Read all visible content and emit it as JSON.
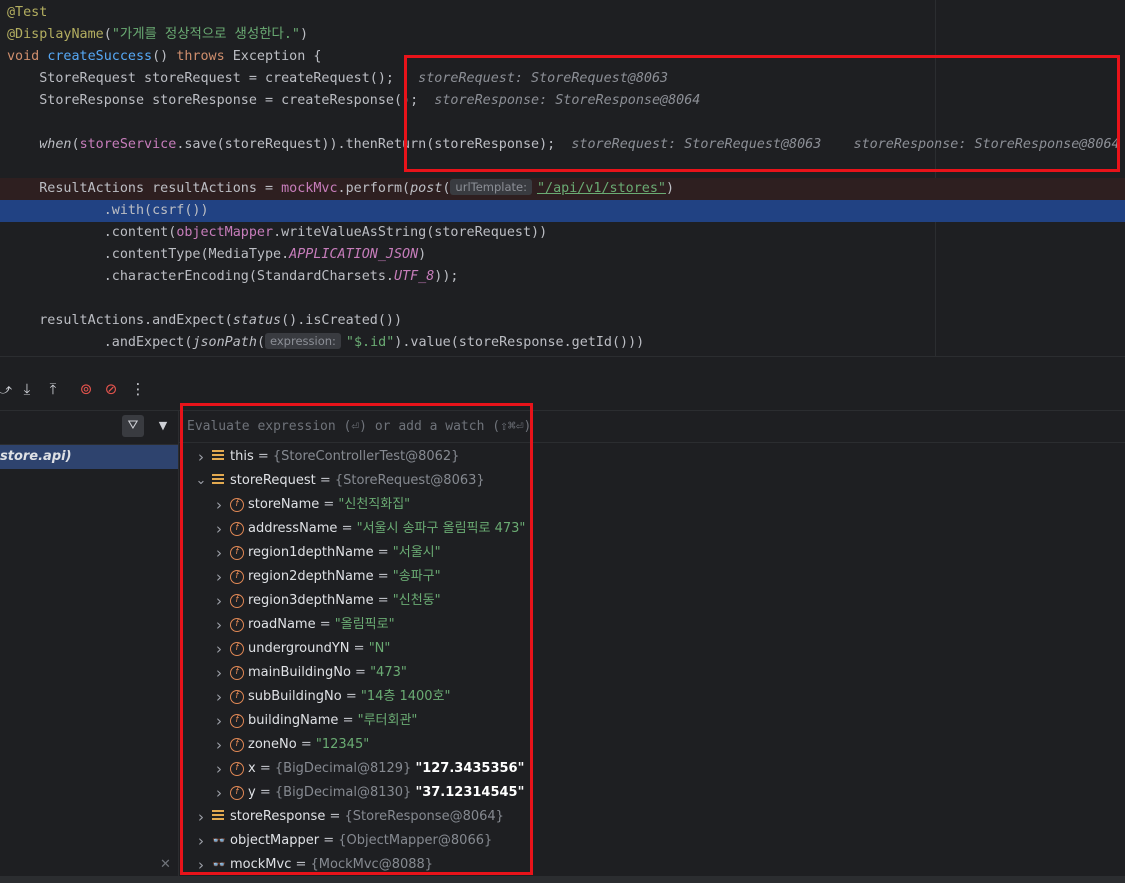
{
  "editor": {
    "lines": {
      "l1": "@Test",
      "l2_ann": "@DisplayName",
      "l2_arg": "\"가게를 정상적으로 생성한다.\"",
      "l3_void": "void ",
      "l3_name": "createSuccess",
      "l3_throws": "throws",
      "l3_exc": " Exception {",
      "l4_code": "    StoreRequest storeRequest = createRequest();",
      "l4_inline": "storeRequest: StoreRequest@8063",
      "l5_code": "    StoreResponse storeResponse = createResponse();",
      "l5_inline": "storeResponse: StoreResponse@8064",
      "l7_when": "when",
      "l7_svc": "storeService",
      "l7_rest": ".save(storeRequest)).thenReturn(storeResponse);",
      "l7_inline1": "storeRequest: StoreRequest@8063",
      "l7_inline2": "storeResponse: StoreResponse@8064",
      "l9_code": "    ResultActions resultActions = ",
      "l9_mock": "mockMvc",
      "l9_perform": ".perform(",
      "l9_post": "post",
      "l9_hint": "urlTemplate:",
      "l9_url": "\"/api/v1/stores\"",
      "l10": "            .with(csrf())",
      "l11_a": "            .content(",
      "l11_mapper": "objectMapper",
      "l11_b": ".writeValueAsString(storeRequest))",
      "l12_a": "            .contentType(MediaType.",
      "l12_const": "APPLICATION_JSON",
      "l13_a": "            .characterEncoding(StandardCharsets.",
      "l13_const": "UTF_8",
      "l15_a": "    resultActions.andExpect(",
      "l15_status": "status",
      "l15_b": "().isCreated())",
      "l16_a": "            .andExpect(",
      "l16_json": "jsonPath",
      "l16_hint": "expression:",
      "l16_str": "\"$.id\"",
      "l16_b": ").value(storeResponse.getId()))"
    }
  },
  "frames": {
    "selected_frame": "store.api)",
    "filter_icon": "filter-icon"
  },
  "variables": {
    "eval_placeholder": "Evaluate expression (⏎) or add a watch (⇧⌘⏎)",
    "rows": [
      {
        "name": "this",
        "type": "{StoreControllerTest@8062}",
        "value": ""
      },
      {
        "name": "storeRequest",
        "type": "{StoreRequest@8063}",
        "value": ""
      },
      {
        "name": "storeName",
        "type": "",
        "value": "\"신천직화집\""
      },
      {
        "name": "addressName",
        "type": "",
        "value": "\"서울시 송파구 올림픽로 473\""
      },
      {
        "name": "region1depthName",
        "type": "",
        "value": "\"서울시\""
      },
      {
        "name": "region2depthName",
        "type": "",
        "value": "\"송파구\""
      },
      {
        "name": "region3depthName",
        "type": "",
        "value": "\"신천동\""
      },
      {
        "name": "roadName",
        "type": "",
        "value": "\"올림픽로\""
      },
      {
        "name": "undergroundYN",
        "type": "",
        "value": "\"N\""
      },
      {
        "name": "mainBuildingNo",
        "type": "",
        "value": "\"473\""
      },
      {
        "name": "subBuildingNo",
        "type": "",
        "value": "\"14층 1400호\""
      },
      {
        "name": "buildingName",
        "type": "",
        "value": "\"루터회관\""
      },
      {
        "name": "zoneNo",
        "type": "",
        "value": "\"12345\""
      },
      {
        "name": "x",
        "type": "{BigDecimal@8129}",
        "value": "\"127.3435356\""
      },
      {
        "name": "y",
        "type": "{BigDecimal@8130}",
        "value": "\"37.12314545\""
      },
      {
        "name": "storeResponse",
        "type": "{StoreResponse@8064}",
        "value": ""
      },
      {
        "name": "objectMapper",
        "type": "{ObjectMapper@8066}",
        "value": ""
      },
      {
        "name": "mockMvc",
        "type": "{MockMvc@8088}",
        "value": ""
      }
    ]
  },
  "colors": {
    "highlight_box": "#e8131a",
    "selection": "#214283"
  }
}
